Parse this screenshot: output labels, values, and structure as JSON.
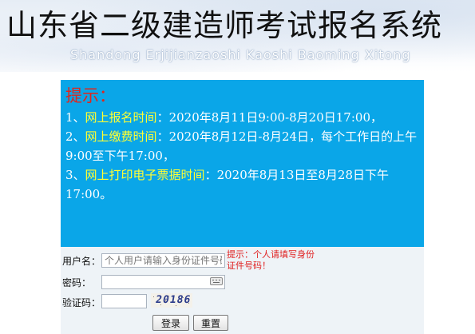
{
  "header": {
    "title_cn": "山东省二级建造师考试报名系统",
    "title_en": "Shandong Erjijianzaoshi Kaoshi Baoming Xitong"
  },
  "notice": {
    "title": "提示：",
    "items": [
      {
        "prefix": "1、",
        "label": "网上报名时间",
        "sep": "：",
        "text": "2020年8月11日9:00-8月20日17:00，"
      },
      {
        "prefix": "2、",
        "label": "网上缴费时间",
        "sep": "：",
        "text": "2020年8月12日-8月24日，每个工作日的上午9:00至下午17:00，"
      },
      {
        "prefix": "3、",
        "label": "网上打印电子票据时间",
        "sep": "：",
        "text": "2020年8月13日至8月28日下午17:00。"
      }
    ]
  },
  "form": {
    "username_label": "用户名：",
    "username_placeholder": "个人用户请输入身份证件号码",
    "username_value": "",
    "username_hint": "提示：个人请填写身份证件号码！",
    "password_label": "密码：",
    "password_value": "",
    "captcha_label": "验证码：",
    "captcha_value": "",
    "captcha_text": "20186",
    "login_label": "登录",
    "reset_label": "重置"
  },
  "colors": {
    "notice_bg": "#0aa6e8",
    "notice_title": "#e0261c",
    "highlight": "#ffff33",
    "hint": "#e02020"
  }
}
